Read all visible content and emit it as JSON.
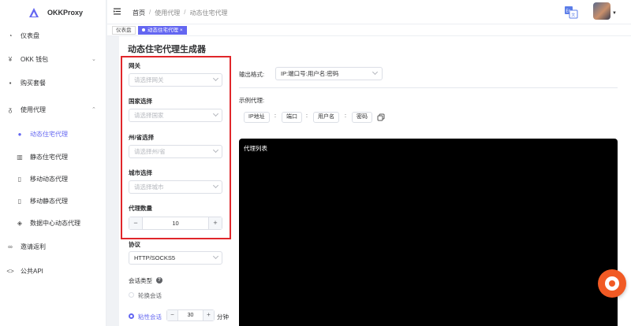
{
  "brand": {
    "name": "OKKProxy",
    "accent": "#6366f1"
  },
  "sidebar": {
    "items": [
      {
        "label": "仪表盘",
        "icon": "dashboard-icon"
      },
      {
        "label": "OKK 钱包",
        "icon": "yen-icon"
      },
      {
        "label": "购买套餐",
        "icon": "cart-icon"
      },
      {
        "label": "使用代理",
        "icon": "proxy-icon"
      },
      {
        "label": "动态住宅代理",
        "icon": "globe-icon"
      },
      {
        "label": "静态住宅代理",
        "icon": "building-icon"
      },
      {
        "label": "移动动态代理",
        "icon": "mobile-icon"
      },
      {
        "label": "移动静态代理",
        "icon": "mobile-icon"
      },
      {
        "label": "数据中心动态代理",
        "icon": "datacenter-icon"
      },
      {
        "label": "邀请返利",
        "icon": "link-icon"
      },
      {
        "label": "公共API",
        "icon": "code-icon"
      }
    ]
  },
  "header": {
    "breadcrumb": [
      "首页",
      "使用代理",
      "动态住宅代理"
    ]
  },
  "tags": {
    "items": [
      {
        "label": "仪表盘"
      },
      {
        "label": "动态住宅代理",
        "close": "×"
      }
    ]
  },
  "main": {
    "title": "动态住宅代理生成器",
    "gateway": {
      "label": "网关",
      "placeholder": "请选择网关"
    },
    "country": {
      "label": "国家选择",
      "placeholder": "请选择国家"
    },
    "state": {
      "label": "州/省选择",
      "placeholder": "请选择州/省"
    },
    "city": {
      "label": "城市选择",
      "placeholder": "请选择城市"
    },
    "quantity": {
      "label": "代理数量",
      "value": "10",
      "minus": "−",
      "plus": "+"
    },
    "protocol": {
      "label": "协议",
      "value": "HTTP/SOCKS5"
    },
    "session": {
      "label": "会话类型",
      "help": "?",
      "rotate": "轮换会话",
      "sticky": "粘性会话",
      "minutes": "30",
      "minus": "−",
      "plus": "+",
      "unit": "分钟"
    },
    "output": {
      "label": "输出格式:",
      "value": "IP:端口号:用户名:密码",
      "example_label": "示例代理:",
      "chips": [
        "IP地址",
        "端口",
        "用户名",
        "密码"
      ],
      "colon": ":"
    },
    "proxy_list": {
      "title": "代理列表"
    }
  }
}
